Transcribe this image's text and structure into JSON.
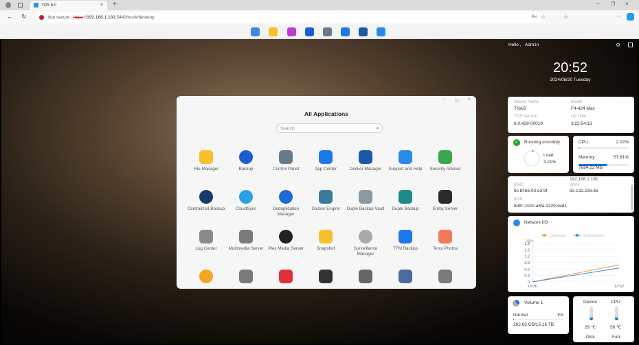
{
  "browser": {
    "tab_title": "TOS 6.0",
    "security": "Not secure",
    "url_scheme": "https",
    "url_host": "://192.168.1.181",
    "url_rest": ":5443/tos/#/desktop"
  },
  "dock": [
    {
      "name": "all-apps",
      "color": "#3a8de0"
    },
    {
      "name": "file-manager",
      "color": "#f7c02c"
    },
    {
      "name": "app-frame",
      "color": "#c03ad0"
    },
    {
      "name": "backup",
      "color": "#1a5fd0"
    },
    {
      "name": "control-panel",
      "color": "#6a7a8a"
    },
    {
      "name": "app-center",
      "color": "#1a7ae8"
    },
    {
      "name": "docker",
      "color": "#1a5aa8"
    },
    {
      "name": "support",
      "color": "#2a8ae8"
    }
  ],
  "header": {
    "greeting": "Hello ,",
    "user": "Adm1n",
    "time": "20:52",
    "date": "2024/08/20 Tuesday"
  },
  "dialog": {
    "title": "All Applications",
    "search_placeholder": "Search",
    "apps": [
      {
        "label": "File Manager",
        "color": "#f7c02c"
      },
      {
        "label": "Backup",
        "color": "#1a5fd0"
      },
      {
        "label": "Control Panel",
        "color": "#6a7a8a"
      },
      {
        "label": "App Center",
        "color": "#1a7ae8"
      },
      {
        "label": "Docker Manager",
        "color": "#1a5aa8"
      },
      {
        "label": "Support and Help",
        "color": "#2a8ae8"
      },
      {
        "label": "Security Advisor",
        "color": "#3aa84a"
      },
      {
        "label": "Centralized Backup",
        "color": "#1a3a6a"
      },
      {
        "label": "CloudSync",
        "color": "#2aa0e8"
      },
      {
        "label": "Deduplication Manager",
        "color": "#1a6ad8"
      },
      {
        "label": "Docker Engine",
        "color": "#3a7a9a"
      },
      {
        "label": "Duple Backup Vault",
        "color": "#8a9aa0"
      },
      {
        "label": "Duple Backup",
        "color": "#1a8a8a"
      },
      {
        "label": "Emby Server",
        "color": "#2a2a2a"
      },
      {
        "label": "Log Center",
        "color": "#8a8a8a"
      },
      {
        "label": "Multimedia Server",
        "color": "#7a7a7a"
      },
      {
        "label": "Plex Media Server",
        "color": "#222222"
      },
      {
        "label": "Snapshot",
        "color": "#f7c02c"
      },
      {
        "label": "Surveillance Manager",
        "color": "#aaaaaa"
      },
      {
        "label": "TFM Backup",
        "color": "#1a7ae8"
      },
      {
        "label": "Terra Photos",
        "color": "#f07a5a"
      },
      {
        "label": "",
        "color": "#f5a623"
      },
      {
        "label": "",
        "color": "#7a7a7a"
      },
      {
        "label": "",
        "color": "#e0303a"
      },
      {
        "label": "",
        "color": "#333333"
      },
      {
        "label": "",
        "color": "#666666"
      },
      {
        "label": "",
        "color": "#4a6aa0"
      },
      {
        "label": "",
        "color": "#7a7a7a"
      }
    ]
  },
  "device": {
    "name_label": "Device Name",
    "name": "TNAS",
    "model_label": "Model",
    "model": "F4-424 Max",
    "tos_label": "TOS Version",
    "tos": "6.0.428-00019",
    "uptime_label": "Up Time",
    "uptime": "3:22:54:13"
  },
  "status": {
    "text": "Running smoothly",
    "load_label": "Load",
    "load": "3.21%",
    "load_value": 3.21
  },
  "resources": {
    "cpu_label": "CPU",
    "cpu": "2.02%",
    "cpu_value": 2.02,
    "mem_label": "Memory",
    "mem": "57.61%",
    "mem_value": 57.61,
    "mem_used": "7684.22 MB"
  },
  "network": {
    "ip_partial": "192.168.1.181",
    "mac_label": "MAC",
    "mac": "6c:bf:b5:03:e3:9f",
    "wan_label": "WAN",
    "wan": "82.132.226.65",
    "ipv6_label": "IPv6",
    "ipv6": "fe80::2c0c:a6fa:1229:4ed1"
  },
  "chart_data": {
    "type": "line",
    "title": "Network I/O",
    "ylabel": "MB/s",
    "x": [
      "15:30",
      "13:52"
    ],
    "yticks": [
      "1.8",
      "1.5",
      "1.2",
      "0.9",
      "0.6",
      "0.3",
      "0"
    ],
    "ylim": [
      0,
      1.8
    ],
    "series": [
      {
        "name": "Upstream",
        "color": "#f0a030",
        "values": [
          0,
          0.8
        ]
      },
      {
        "name": "Downstream",
        "color": "#3a8ee8",
        "values": [
          0,
          0.65
        ]
      }
    ]
  },
  "volume": {
    "name": "Volume 1",
    "status": "Normal",
    "pct": "1%",
    "pct_value": 1,
    "usage": "262.63 GB/15.16 TB"
  },
  "temps": {
    "device_label": "Device",
    "device": "29 ℃",
    "cpu_label": "CPU",
    "cpu": "56 ℃",
    "disk_label": "Disk",
    "fan_label": "Fan"
  }
}
